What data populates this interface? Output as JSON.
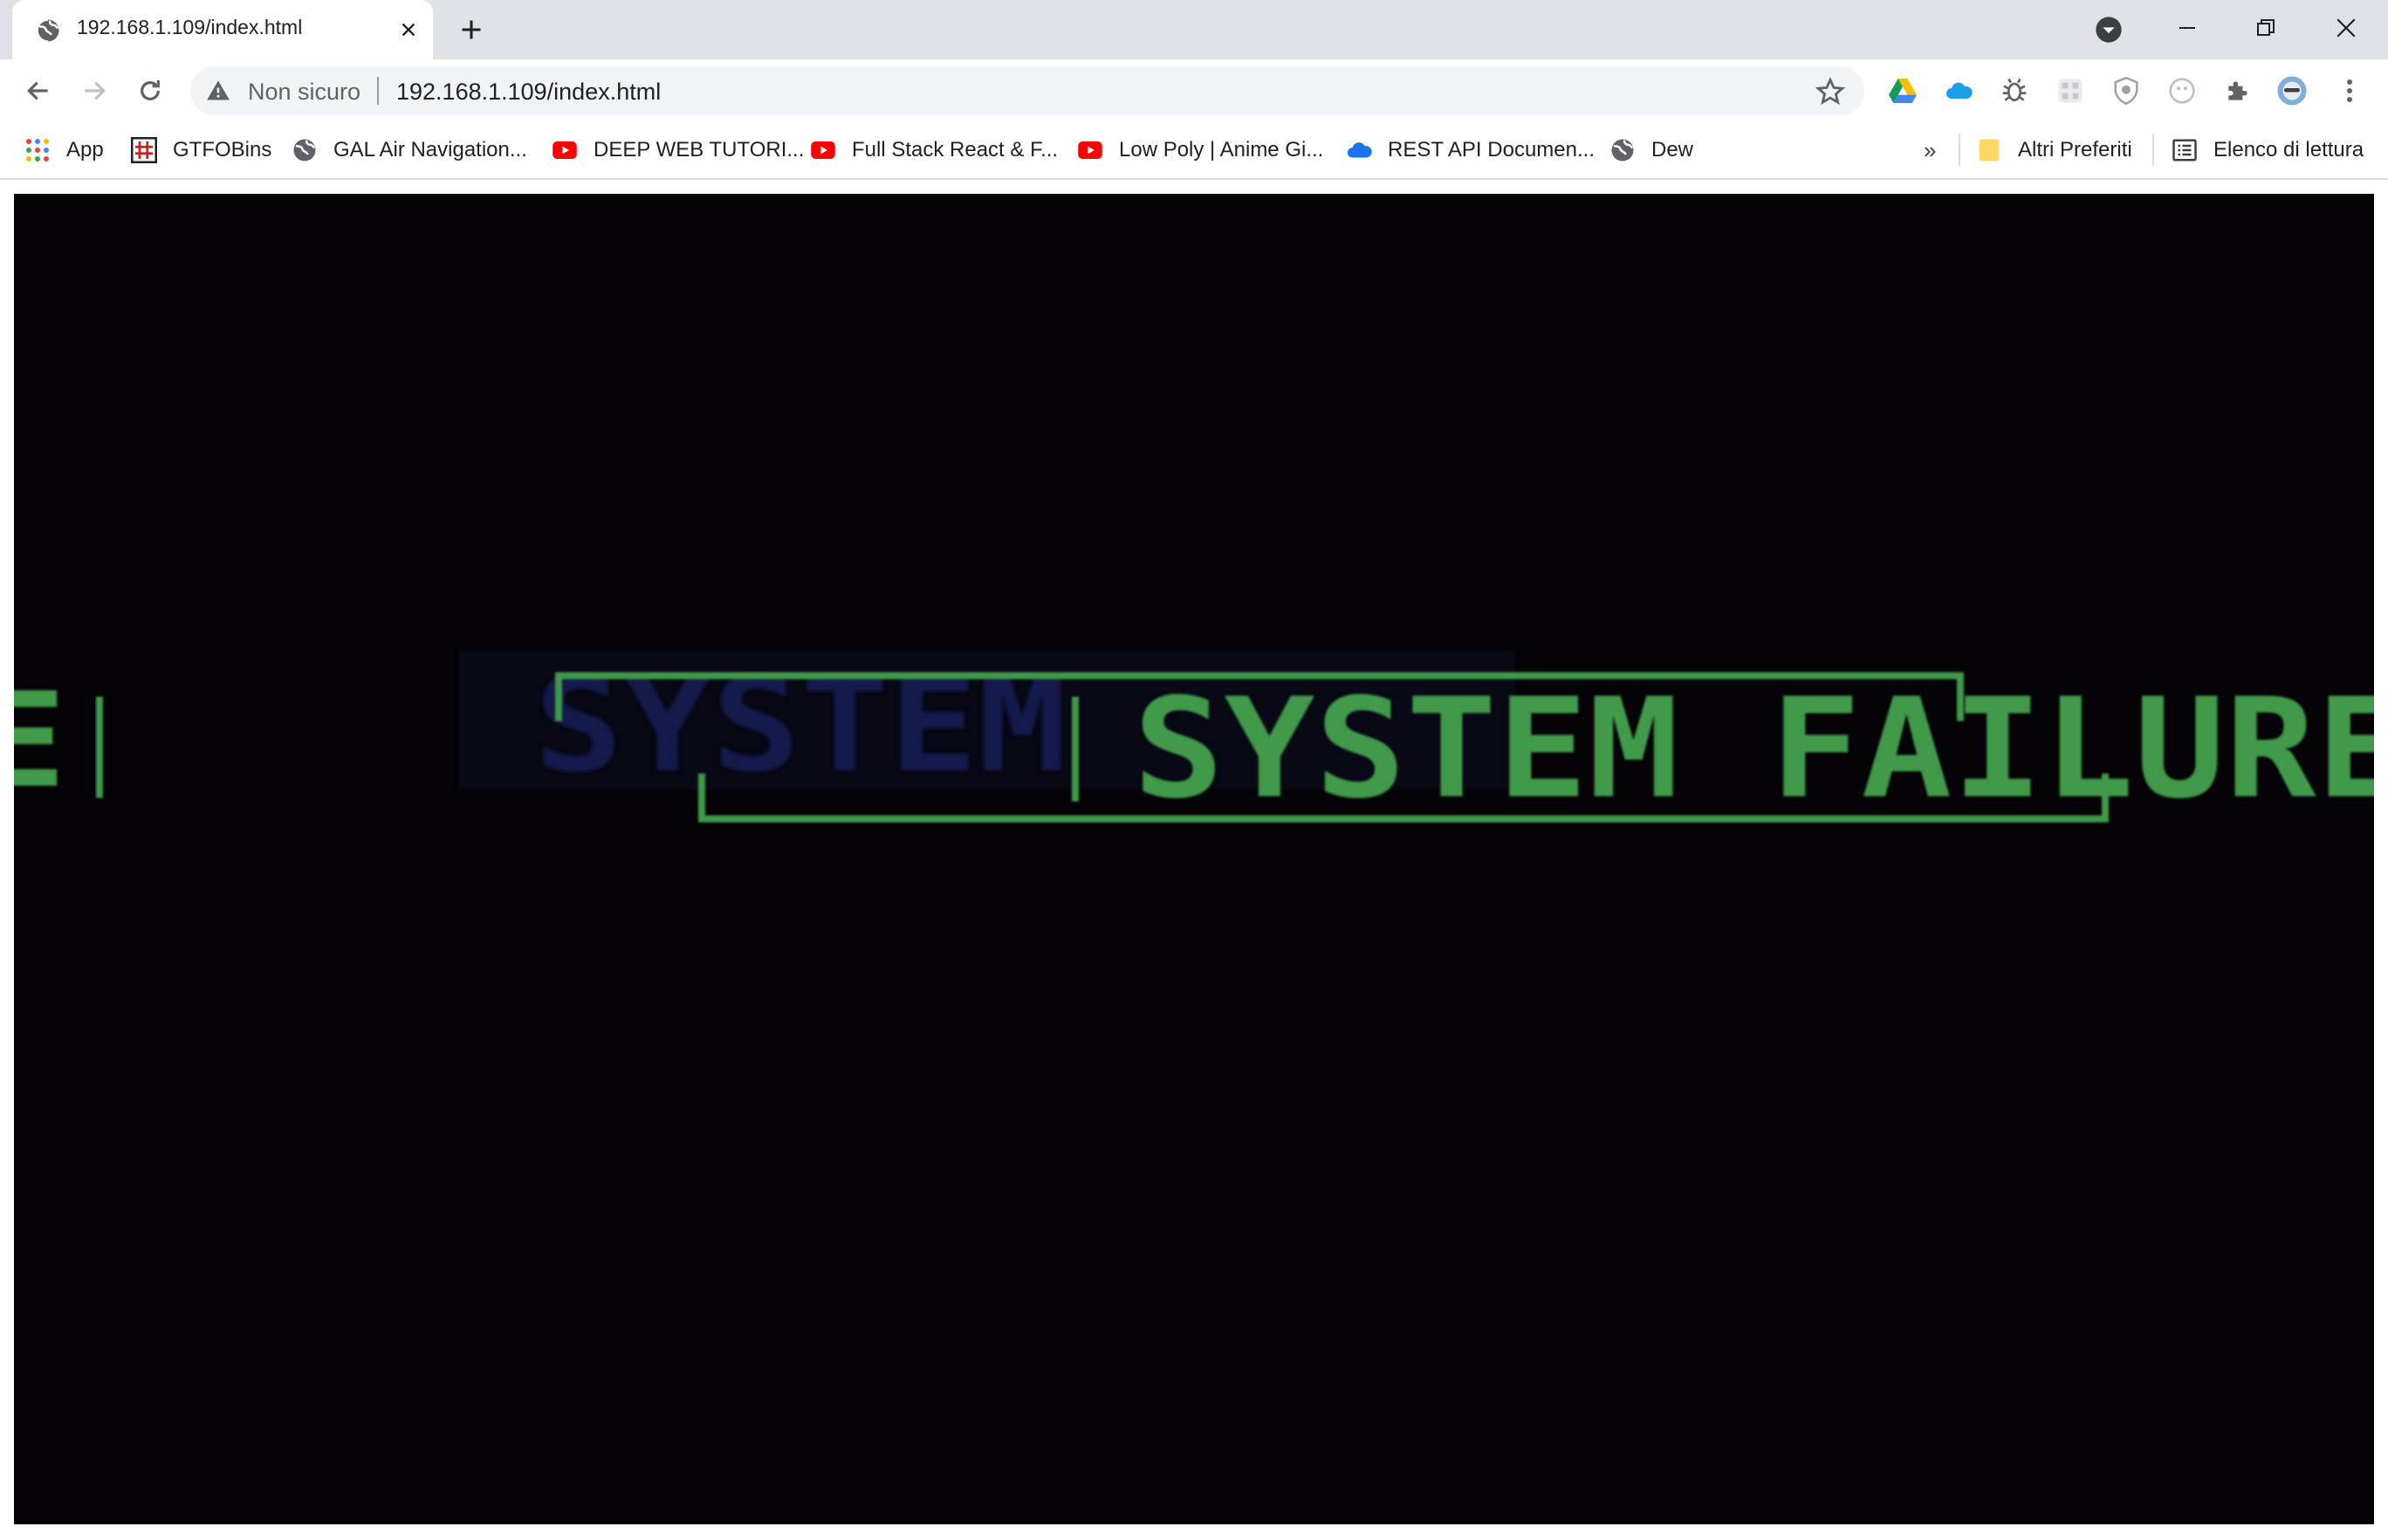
{
  "browser": {
    "tab": {
      "title": "192.168.1.109/index.html",
      "favicon": "globe-icon"
    },
    "omnibox": {
      "security_label": "Non sicuro",
      "url": "192.168.1.109/index.html"
    },
    "bookmarks": [
      {
        "label": "App",
        "icon": "apps-grid-icon"
      },
      {
        "label": "GTFOBins",
        "icon": "gtfobins-icon"
      },
      {
        "label": "GAL Air Navigation...",
        "icon": "globe-icon"
      },
      {
        "label": "DEEP WEB TUTORI...",
        "icon": "youtube-icon"
      },
      {
        "label": "Full Stack React & F...",
        "icon": "youtube-icon"
      },
      {
        "label": "Low Poly | Anime Gi...",
        "icon": "youtube-icon"
      },
      {
        "label": "REST API Documen...",
        "icon": "cloud-icon"
      },
      {
        "label": "Dew",
        "icon": "globe-icon"
      }
    ],
    "overflow_label": "»",
    "other_bookmarks": "Altri Preferiti",
    "reading_list": "Elenco di lettura"
  },
  "content": {
    "main_text": "SYSTEM FAILURE",
    "ghost_text": "SYSTEM",
    "left_fragment": "E",
    "text_color": "#3f9a4a",
    "ghost_color": "#141a4a",
    "background": "#050307"
  },
  "colors": {
    "tabstrip": "#dee1e6",
    "youtube_red": "#ff0000",
    "accent_blue": "#1a73e8"
  }
}
